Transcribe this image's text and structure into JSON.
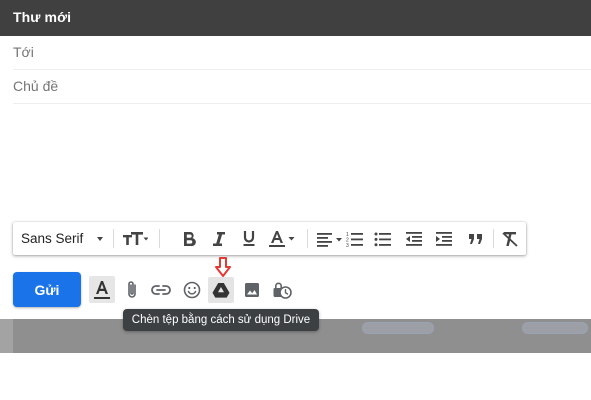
{
  "compose": {
    "title": "Thư mới",
    "to_placeholder": "Tới",
    "subject_placeholder": "Chủ đề"
  },
  "format_toolbar": {
    "font_name": "Sans Serif",
    "tools": [
      "font-size",
      "bold",
      "italic",
      "underline",
      "text-color",
      "align",
      "numbered-list",
      "bulleted-list",
      "indent-less",
      "indent-more",
      "quote",
      "remove-formatting"
    ]
  },
  "actions": {
    "send_label": "Gửi",
    "icons": [
      "formatting-options-icon",
      "attach-icon",
      "link-icon",
      "emoji-icon",
      "drive-icon",
      "photo-icon",
      "confidential-mode-icon"
    ]
  },
  "tooltip": {
    "text": "Chèn tệp bằng cách sử dụng Drive"
  },
  "colors": {
    "header_bg": "#404040",
    "send_button": "#1a73e8",
    "annotation_arrow": "#e53935",
    "tooltip_bg": "#3c4043"
  }
}
